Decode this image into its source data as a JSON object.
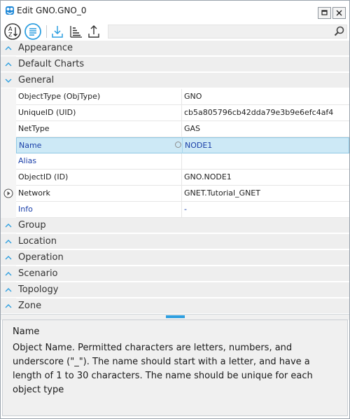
{
  "window": {
    "title": "Edit GNO.GNO_0",
    "restore_label": "restore",
    "close_label": "close"
  },
  "toolbar": {
    "search_value": "",
    "search_placeholder": ""
  },
  "categories": [
    {
      "label": "Appearance",
      "expanded": false
    },
    {
      "label": "Default Charts",
      "expanded": false
    },
    {
      "label": "General",
      "expanded": true
    },
    {
      "label": "Group",
      "expanded": false
    },
    {
      "label": "Location",
      "expanded": false
    },
    {
      "label": "Operation",
      "expanded": false
    },
    {
      "label": "Scenario",
      "expanded": false
    },
    {
      "label": "Topology",
      "expanded": false
    },
    {
      "label": "Zone",
      "expanded": false
    }
  ],
  "general_rows": [
    {
      "name": "ObjectType (ObjType)",
      "value": "GNO"
    },
    {
      "name": "UniqueID (UID)",
      "value": "cb5a805796cb42dda79e3b9e6efc4af4"
    },
    {
      "name": "NetType",
      "value": "GAS"
    },
    {
      "name": "Name",
      "value": "NODE1"
    },
    {
      "name": "Alias",
      "value": ""
    },
    {
      "name": "ObjectID (ID)",
      "value": "GNO.NODE1"
    },
    {
      "name": "Network",
      "value": "GNET.Tutorial_GNET"
    },
    {
      "name": "Info",
      "value": "-"
    }
  ],
  "description": {
    "title": "Name",
    "text": "Object Name. Permitted characters are letters, numbers, and underscore (\"_\"). The name should start with a letter, and have a length of 1 to 30 characters. The name should be unique for each object type"
  },
  "colors": {
    "accent": "#2e9fe0",
    "selection": "#cde9f6",
    "link_text": "#1a3fa8"
  }
}
